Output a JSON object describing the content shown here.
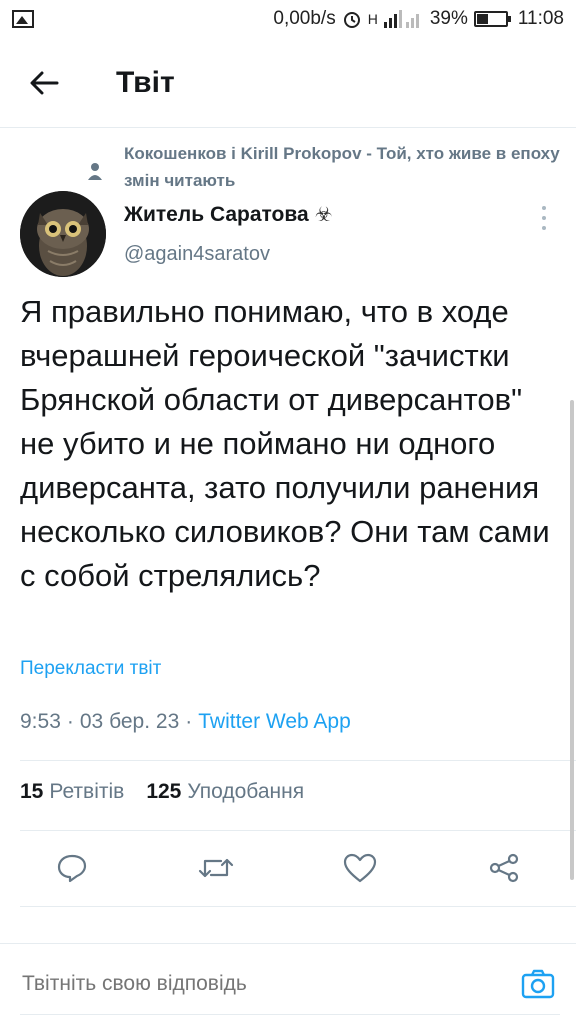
{
  "status_bar": {
    "network_speed": "0,00b/s",
    "signal": "H",
    "battery_percent": "39%",
    "battery_level": 0.39,
    "time": "11:08"
  },
  "header": {
    "title": "Твіт"
  },
  "social_context": {
    "text": "Кокошенков і Kirill Prokopov - Той, хто живе в епоху змін читають"
  },
  "author": {
    "name": "Житель Саратова",
    "emoji": "☣",
    "handle": "@again4saratov"
  },
  "tweet": {
    "text": "Я правильно понимаю, что в ходе вчерашней героической \"зачистки Брянской области от диверсантов\" не убито и не поймано ни одного диверсанта, зато получили ранения несколько силовиков? Они там сами с собой стрелялись?",
    "translate_label": "Перекласти твіт",
    "time": "9:53",
    "date": "03 бер. 23",
    "separator": "·",
    "source": "Twitter Web App"
  },
  "stats": {
    "retweets_count": "15",
    "retweets_label": "Ретвітів",
    "likes_count": "125",
    "likes_label": "Уподобання"
  },
  "actions": [
    "reply-icon",
    "retweet-icon",
    "like-icon",
    "share-icon"
  ],
  "reply": {
    "placeholder": "Твітніть свою відповідь"
  },
  "colors": {
    "accent": "#1da1f2",
    "secondary_text": "#657786",
    "primary_text": "#14171a",
    "divider": "#e6ecf0"
  }
}
